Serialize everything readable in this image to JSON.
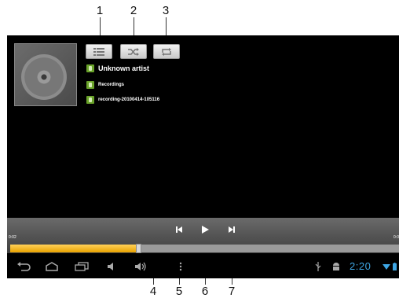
{
  "callouts": [
    "1",
    "2",
    "3",
    "4",
    "5",
    "6",
    "7"
  ],
  "player": {
    "artist": "Unknown artist",
    "album": "Recordings",
    "track": "recording-20100414-105116",
    "time_elapsed": "0:02",
    "time_total": "0:0",
    "progress": 0.33,
    "accent": "#f4b400"
  },
  "buttons": {
    "playlist": "list-icon",
    "shuffle": "shuffle-icon",
    "repeat": "repeat-icon",
    "prev": "skip-previous-icon",
    "play": "play-icon",
    "next": "skip-next-icon"
  },
  "system_bar": {
    "clock": "2:20",
    "clock_color": "#3ea6e4"
  }
}
